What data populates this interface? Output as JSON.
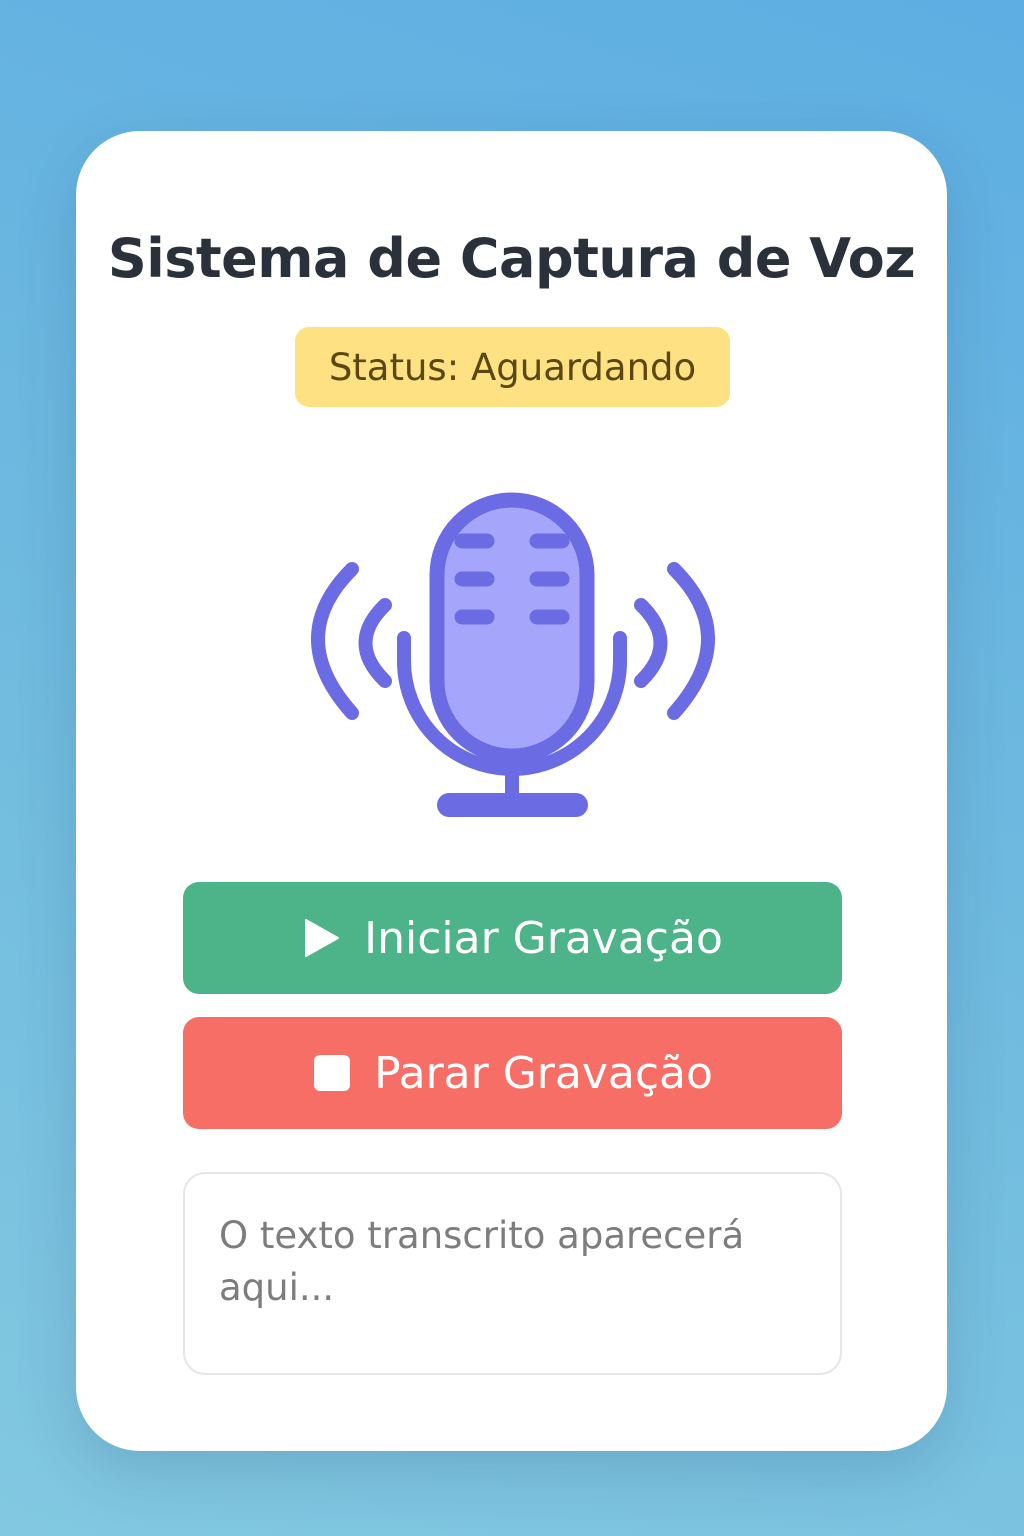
{
  "app": {
    "title": "Sistema de Captura de Voz"
  },
  "status": {
    "text": "Status: Aguardando",
    "color": "#fde182"
  },
  "microphone": {
    "icon": "microphone-icon",
    "color": "#6b6be4",
    "fill": "#a5a5fb"
  },
  "buttons": {
    "start": {
      "label": "Iniciar Gravação",
      "icon": "play-icon",
      "color": "#4db388"
    },
    "stop": {
      "label": "Parar Gravação",
      "icon": "stop-icon",
      "color": "#f76e67"
    }
  },
  "transcript": {
    "value": "",
    "placeholder": "O texto transcrito aparecerá aqui..."
  }
}
